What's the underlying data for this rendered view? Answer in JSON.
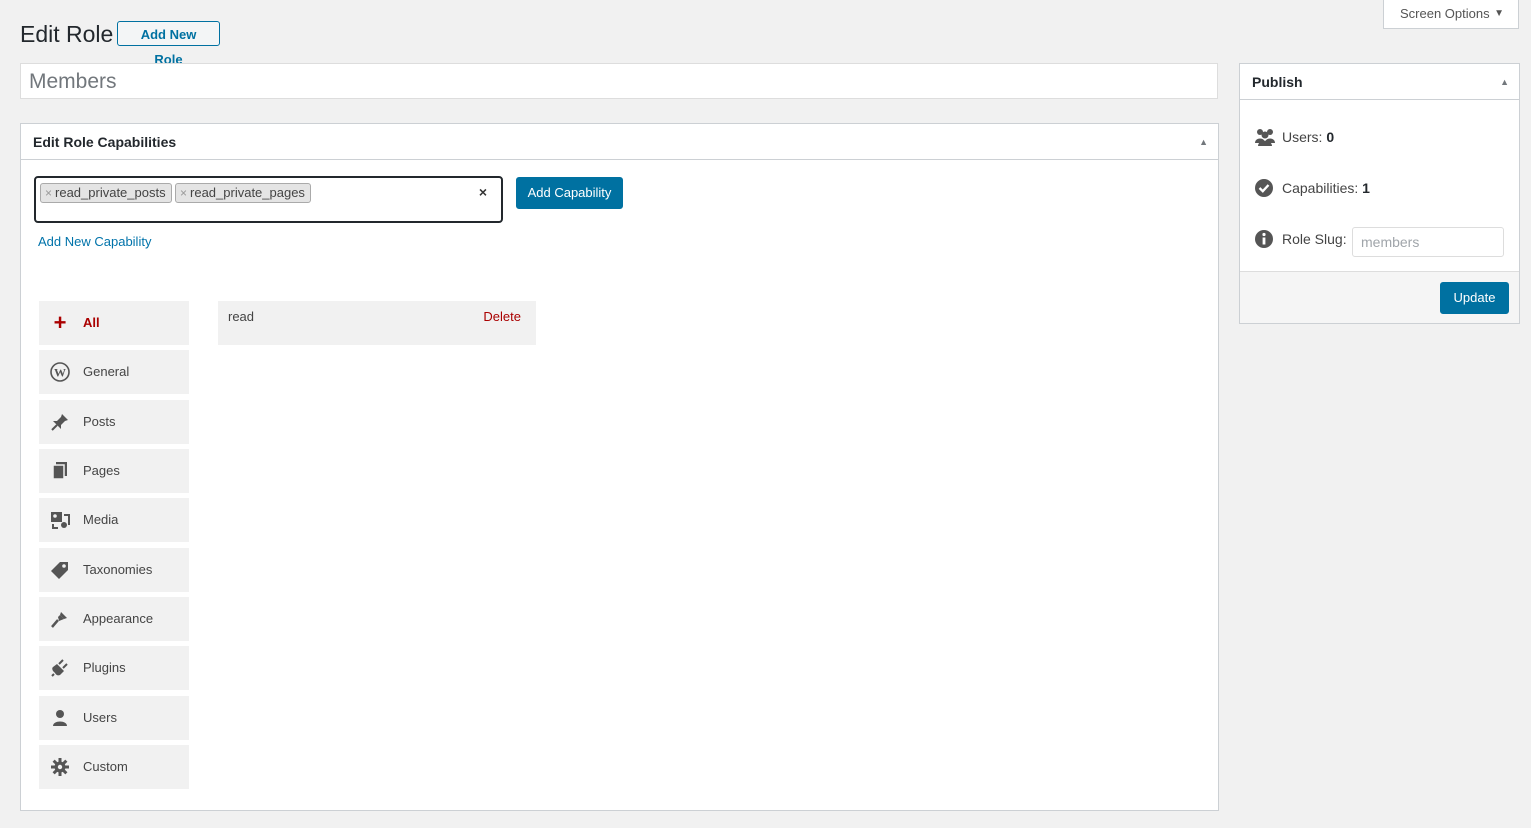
{
  "header": {
    "title": "Edit Role",
    "add_new_label": "Add New Role",
    "screen_options_label": "Screen Options"
  },
  "role": {
    "name_value": "Members"
  },
  "capabilities_box": {
    "title": "Edit Role Capabilities",
    "selected_chips": [
      "read_private_posts",
      "read_private_pages"
    ],
    "add_button_label": "Add Capability",
    "add_new_link": "Add New Capability",
    "tabs": [
      {
        "label": "All",
        "icon": "plus-icon",
        "active": true
      },
      {
        "label": "General",
        "icon": "wordpress-icon"
      },
      {
        "label": "Posts",
        "icon": "pushpin-icon"
      },
      {
        "label": "Pages",
        "icon": "pages-icon"
      },
      {
        "label": "Media",
        "icon": "media-icon"
      },
      {
        "label": "Taxonomies",
        "icon": "tag-icon"
      },
      {
        "label": "Appearance",
        "icon": "brush-icon"
      },
      {
        "label": "Plugins",
        "icon": "plugin-icon"
      },
      {
        "label": "Users",
        "icon": "user-icon"
      },
      {
        "label": "Custom",
        "icon": "gear-icon"
      }
    ],
    "capabilities": [
      {
        "name": "read",
        "action": "Delete"
      }
    ]
  },
  "publish": {
    "title": "Publish",
    "users_label": "Users:",
    "users_count": "0",
    "caps_label": "Capabilities:",
    "caps_count": "1",
    "slug_label": "Role Slug:",
    "slug_placeholder": "members",
    "update_label": "Update"
  },
  "colors": {
    "accent": "#0071a1",
    "danger": "#aa0000",
    "background": "#f1f1f1"
  }
}
